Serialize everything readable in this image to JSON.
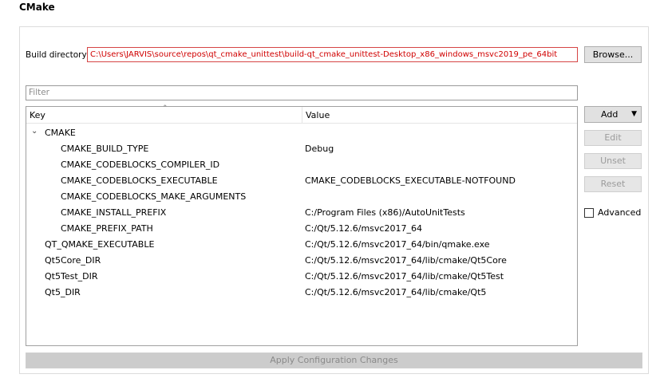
{
  "title": "CMake",
  "build_dir": {
    "label": "Build directory:",
    "value": "C:\\Users\\JARVIS\\source\\repos\\qt_cmake_unittest\\build-qt_cmake_unittest-Desktop_x86_windows_msvc2019_pe_64bit",
    "browse": "Browse..."
  },
  "filter_placeholder": "Filter",
  "tree": {
    "col_key": "Key",
    "col_value": "Value",
    "rows": [
      {
        "key": "CMAKE",
        "value": ""
      },
      {
        "key": "CMAKE_BUILD_TYPE",
        "value": "Debug"
      },
      {
        "key": "CMAKE_CODEBLOCKS_COMPILER_ID",
        "value": ""
      },
      {
        "key": "CMAKE_CODEBLOCKS_EXECUTABLE",
        "value": "CMAKE_CODEBLOCKS_EXECUTABLE-NOTFOUND"
      },
      {
        "key": "CMAKE_CODEBLOCKS_MAKE_ARGUMENTS",
        "value": ""
      },
      {
        "key": "CMAKE_INSTALL_PREFIX",
        "value": "C:/Program Files (x86)/AutoUnitTests"
      },
      {
        "key": "CMAKE_PREFIX_PATH",
        "value": "C:/Qt/5.12.6/msvc2017_64"
      },
      {
        "key": "QT_QMAKE_EXECUTABLE",
        "value": "C:/Qt/5.12.6/msvc2017_64/bin/qmake.exe"
      },
      {
        "key": "Qt5Core_DIR",
        "value": "C:/Qt/5.12.6/msvc2017_64/lib/cmake/Qt5Core"
      },
      {
        "key": "Qt5Test_DIR",
        "value": "C:/Qt/5.12.6/msvc2017_64/lib/cmake/Qt5Test"
      },
      {
        "key": "Qt5_DIR",
        "value": "C:/Qt/5.12.6/msvc2017_64/lib/cmake/Qt5"
      }
    ]
  },
  "side_buttons": {
    "add": "Add",
    "edit": "Edit",
    "unset": "Unset",
    "reset": "Reset"
  },
  "advanced_label": "Advanced",
  "advanced_checked": false,
  "apply_label": "Apply Configuration Changes",
  "colors": {
    "error_text": "#d00000",
    "error_border": "#d64545"
  }
}
